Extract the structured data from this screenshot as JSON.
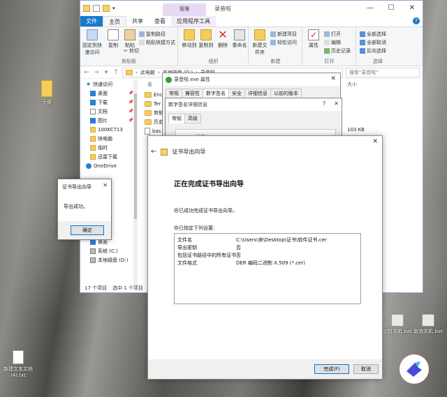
{
  "explorer": {
    "window_title": "录音啦",
    "tool_tab_group": "管理",
    "ribbon_tabs": [
      "文件",
      "主页",
      "共享",
      "查看",
      "应用程序工具"
    ],
    "ribbon": {
      "pin_label": "固定到快速访问",
      "copy_label": "复制",
      "paste_label": "粘贴",
      "copy_path": "复制路径",
      "paste_shortcut": "粘贴快捷方式",
      "cut": "剪切",
      "clipboard_group": "剪贴板",
      "move_to": "移动到",
      "copy_to": "复制到",
      "delete": "删除",
      "rename": "重命名",
      "organize_group": "组织",
      "new_folder": "新建文件夹",
      "new_item": "新建项目",
      "easy_access": "轻松访问",
      "new_group": "新建",
      "properties": "属性",
      "open": "打开",
      "edit": "编辑",
      "history": "历史记录",
      "open_group": "打开",
      "select_all": "全部选择",
      "select_none": "全部取消",
      "invert_selection": "反向选择",
      "select_group": "选择"
    },
    "address_path": [
      "此电脑",
      "本地磁盘 (D:)",
      "录音啦"
    ],
    "search_placeholder": "搜索\"录音啦\"",
    "nav_items": [
      {
        "label": "快速访问",
        "type": "star"
      },
      {
        "label": "桌面",
        "type": "desktop",
        "pinned": true
      },
      {
        "label": "下载",
        "type": "download",
        "pinned": true
      },
      {
        "label": "文档",
        "type": "doc",
        "pinned": true
      },
      {
        "label": "图片",
        "type": "pic",
        "pinned": true
      },
      {
        "label": "100KC713",
        "type": "folder"
      },
      {
        "label": "快电脑",
        "type": "folder"
      },
      {
        "label": "临时",
        "type": "folder"
      },
      {
        "label": "迅雷下载",
        "type": "folder"
      },
      {
        "label": "OneDrive",
        "type": "cloud"
      }
    ],
    "nav_items_lower": [
      {
        "label": "下载",
        "type": "download"
      },
      {
        "label": "音乐",
        "type": "music"
      },
      {
        "label": "桌面",
        "type": "desktop"
      },
      {
        "label": "系统 (C:)",
        "type": "drive"
      },
      {
        "label": "本地磁盘 (D:)",
        "type": "drive"
      }
    ],
    "col_name": "名",
    "col_size": "大小",
    "files": [
      "Enc",
      "Ter",
      "剪辑",
      "历史",
      "bas"
    ],
    "size_value": "103 KB",
    "status_items": "17 个项目",
    "status_selected": "选中 1 个项目",
    "status_trunc": "6."
  },
  "props": {
    "title": "录音啦.exe 属性",
    "tabs": [
      "常规",
      "兼容性",
      "数字签名",
      "安全",
      "详细信息",
      "以前的版本"
    ]
  },
  "sigdetail": {
    "title": "数字签名详细信息",
    "tabs": [
      "常规",
      "高级"
    ],
    "behind_label": "证书"
  },
  "wizard": {
    "title": "证书导出向导",
    "heading": "正在完成证书导出向导",
    "done_text": "你已成功完成证书导出向导。",
    "specified_text": "你已指定下列设置:",
    "settings": [
      {
        "key": "文件名",
        "value": "C:\\Users\\宋\\Desktop\\证书\\软件证书.cer"
      },
      {
        "key": "导出密钥",
        "value": "否"
      },
      {
        "key": "包括证书路径中的所有证书",
        "value": "否"
      },
      {
        "key": "文件格式",
        "value": "DER 编码二进制 X.509 (*.cer)"
      }
    ],
    "finish_button": "完成(F)",
    "cancel_button": "取消"
  },
  "msgbox": {
    "title": "证书导出向导",
    "text": "导出成功。",
    "ok_button": "确定"
  },
  "desktop": {
    "icon_top_left": "干部",
    "icon_bottom_left": "新建文本文档 (4).txt",
    "icon_bat1": "定时关机.bat",
    "icon_bat2": "取消关机.bat",
    "brand_color": "#1979ca"
  }
}
